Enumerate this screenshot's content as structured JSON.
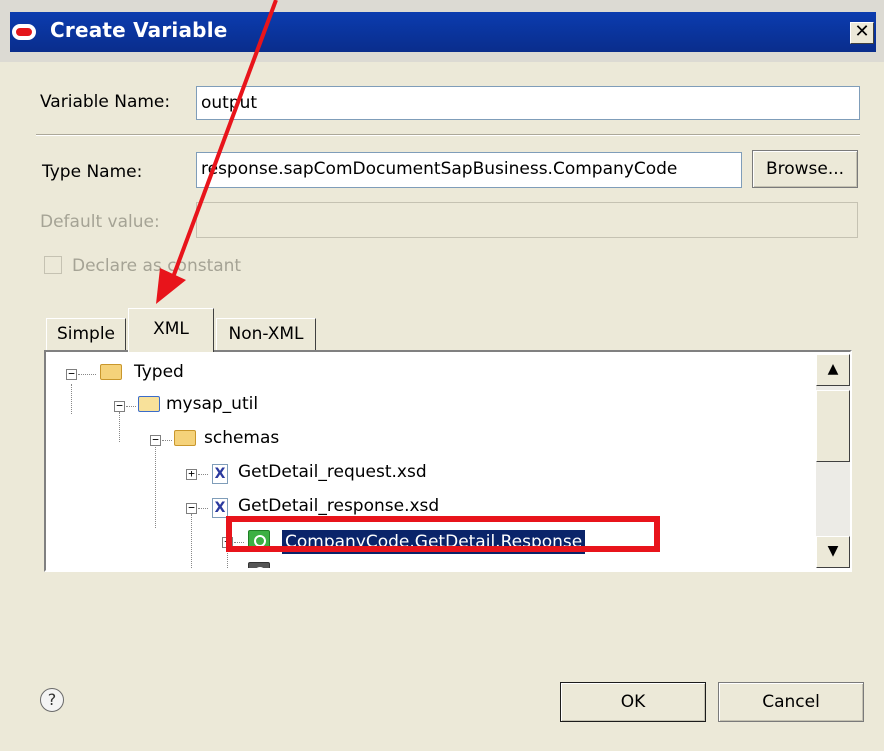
{
  "window": {
    "title": "Create Variable",
    "close_glyph": "✕"
  },
  "form": {
    "variable_name_label": "Variable Name:",
    "variable_name_value": "output",
    "type_name_label": "Type Name:",
    "type_name_value": "response.sapComDocumentSapBusiness.CompanyCode",
    "browse_label": "Browse...",
    "default_value_label": "Default value:",
    "default_value_value": "",
    "declare_constant_label": "Declare as constant",
    "declare_constant_checked": false
  },
  "tabs": [
    {
      "label": "Simple",
      "active": false
    },
    {
      "label": "XML",
      "active": true
    },
    {
      "label": "Non-XML",
      "active": false
    }
  ],
  "tree": {
    "nodes": [
      {
        "label": "Typed",
        "icon": "typed-folder-icon",
        "expander": "−"
      },
      {
        "label": "mysap_util",
        "icon": "project-folder-icon",
        "expander": "−"
      },
      {
        "label": "schemas",
        "icon": "folder-icon",
        "expander": "−"
      },
      {
        "label": "GetDetail_request.xsd",
        "icon": "xsd-file-icon",
        "expander": "+"
      },
      {
        "label": "GetDetail_response.xsd",
        "icon": "xsd-file-icon",
        "expander": "−"
      },
      {
        "label": "CompanyCode.GetDetail.Response",
        "icon": "element-icon",
        "expander": "+",
        "selected": true
      }
    ]
  },
  "scrollbar": {
    "up_glyph": "▲",
    "down_glyph": "▼"
  },
  "footer": {
    "help_glyph": "?",
    "ok_label": "OK",
    "cancel_label": "Cancel"
  },
  "annotation": {
    "arrow_color": "#e8141b",
    "box_color": "#e8141b"
  }
}
